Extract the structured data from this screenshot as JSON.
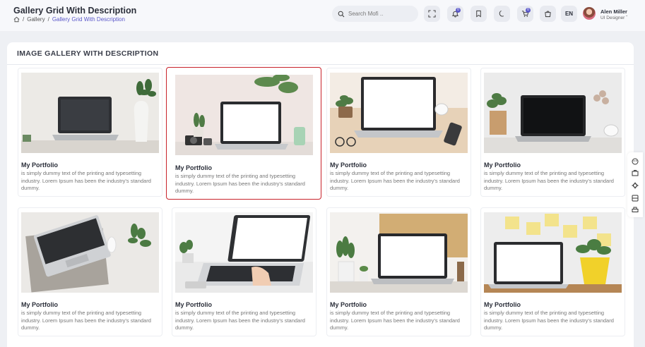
{
  "header": {
    "title": "Gallery Grid With Description",
    "breadcrumb": [
      "Gallery",
      "Gallery Grid With Description"
    ],
    "search_placeholder": "Search Mofi ..",
    "notification_count": "0",
    "cart_count": "0",
    "language": "EN",
    "user": {
      "name": "Alen Miller",
      "role": "UI Designer"
    }
  },
  "panel": {
    "title": "IMAGE GALLERY WITH DESCRIPTION"
  },
  "cards": [
    {
      "title": "My Portfolio",
      "desc": "is simply dummy text of the printing and typesetting industry. Lorem Ipsum has been the industry's standard dummy."
    },
    {
      "title": "My Portfolio",
      "desc": "is simply dummy text of the printing and typesetting industry. Lorem Ipsum has been the industry's standard dummy."
    },
    {
      "title": "My Portfolio",
      "desc": "is simply dummy text of the printing and typesetting industry. Lorem Ipsum has been the industry's standard dummy."
    },
    {
      "title": "My Portfolio",
      "desc": "is simply dummy text of the printing and typesetting industry. Lorem Ipsum has been the industry's standard dummy."
    },
    {
      "title": "My Portfolio",
      "desc": "is simply dummy text of the printing and typesetting industry. Lorem Ipsum has been the industry's standard dummy."
    },
    {
      "title": "My Portfolio",
      "desc": "is simply dummy text of the printing and typesetting industry. Lorem Ipsum has been the industry's standard dummy."
    },
    {
      "title": "My Portfolio",
      "desc": "is simply dummy text of the printing and typesetting industry. Lorem Ipsum has been the industry's standard dummy."
    },
    {
      "title": "My Portfolio",
      "desc": "is simply dummy text of the printing and typesetting industry. Lorem Ipsum has been the industry's standard dummy."
    }
  ],
  "colors": {
    "accent": "#5a57c9",
    "selected_border": "#c8232b"
  }
}
